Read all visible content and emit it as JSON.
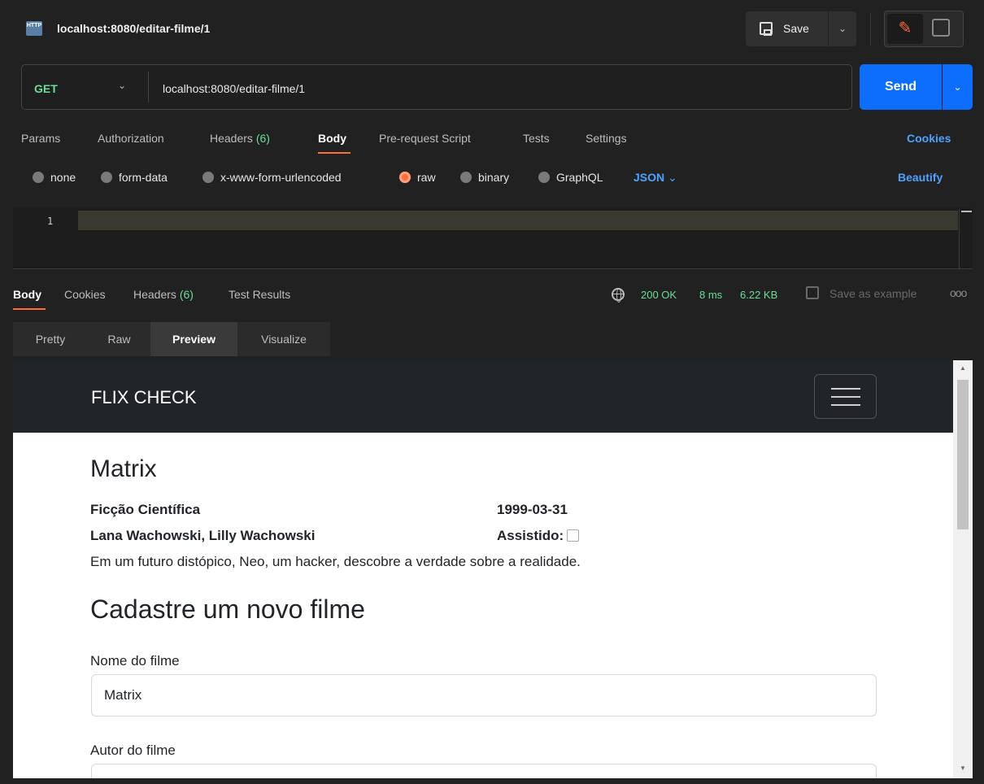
{
  "window": {
    "tab_icon_text": "HTTP",
    "tab_title": "localhost:8080/editar-filme/1",
    "save_label": "Save"
  },
  "request": {
    "method": "GET",
    "url": "localhost:8080/editar-filme/1",
    "send_label": "Send"
  },
  "request_tabs": {
    "params": "Params",
    "authorization": "Authorization",
    "headers": "Headers",
    "headers_count": "(6)",
    "body": "Body",
    "prerequest": "Pre-request Script",
    "tests": "Tests",
    "settings": "Settings",
    "cookies": "Cookies",
    "active": "Body"
  },
  "body_types": {
    "none": "none",
    "form_data": "form-data",
    "urlencoded": "x-www-form-urlencoded",
    "raw": "raw",
    "binary": "binary",
    "graphql": "GraphQL",
    "selected": "raw",
    "language": "JSON",
    "beautify": "Beautify"
  },
  "editor": {
    "line_number": "1",
    "content": ""
  },
  "response_tabs": {
    "body": "Body",
    "cookies": "Cookies",
    "headers": "Headers",
    "headers_count": "(6)",
    "test_results": "Test Results",
    "active": "Body"
  },
  "response_status": {
    "status": "200 OK",
    "time": "8 ms",
    "size": "6.22 KB",
    "save_example": "Save as example",
    "more": "ooo"
  },
  "view_tabs": {
    "pretty": "Pretty",
    "raw": "Raw",
    "preview": "Preview",
    "visualize": "Visualize",
    "active": "Preview"
  },
  "preview": {
    "brand": "FLIX CHECK",
    "movie_title": "Matrix",
    "genre": "Ficção Científica",
    "release_date": "1999-03-31",
    "directors": "Lana Wachowski, Lilly Wachowski",
    "watched_label": "Assistido:",
    "watched": false,
    "description": "Em um futuro distópico, Neo, um hacker, descobre a verdade sobre a realidade.",
    "form_heading": "Cadastre um novo filme",
    "name_label": "Nome do filme",
    "name_value": "Matrix",
    "author_label": "Autor do filme",
    "author_value": ""
  },
  "colors": {
    "accent": "#ff6c37",
    "send_button": "#0d6efd",
    "success": "#6bdd9a",
    "link": "#4ea2ff"
  }
}
